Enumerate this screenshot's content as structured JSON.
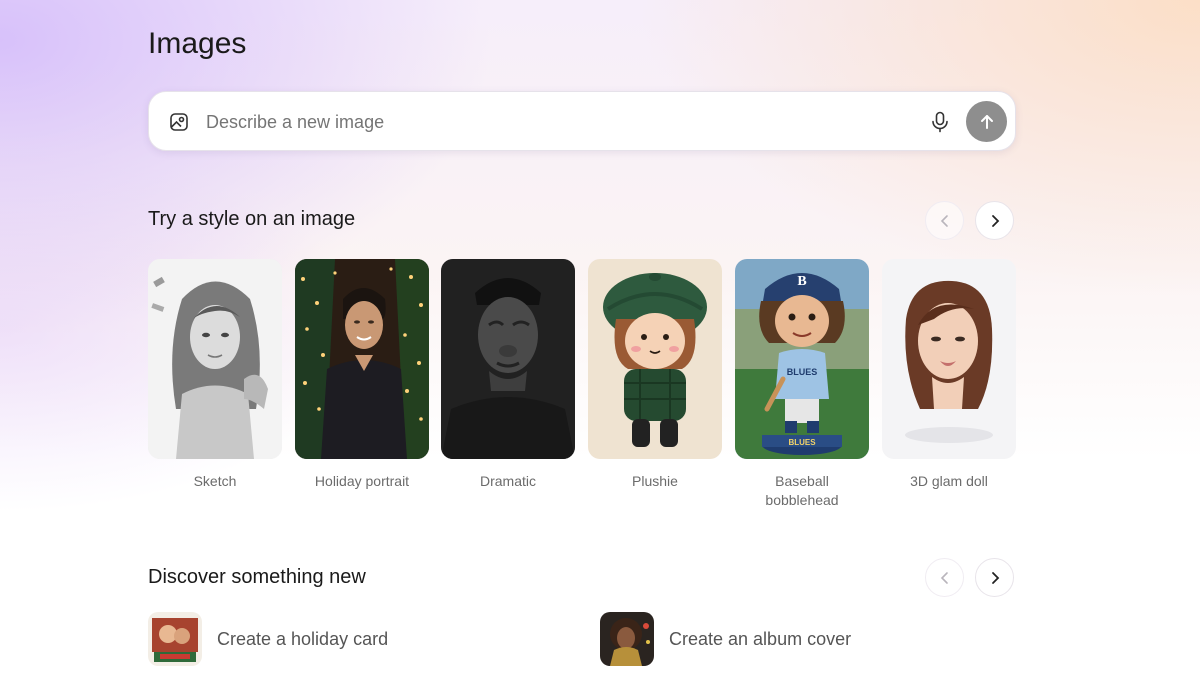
{
  "page": {
    "title": "Images"
  },
  "search": {
    "placeholder": "Describe a new image",
    "icons": {
      "image": "image-icon",
      "mic": "microphone-icon",
      "send": "arrow-up-icon"
    }
  },
  "styles_section": {
    "title": "Try a style on an image",
    "items": [
      {
        "label": "Sketch"
      },
      {
        "label": "Holiday portrait"
      },
      {
        "label": "Dramatic"
      },
      {
        "label": "Plushie"
      },
      {
        "label": "Baseball bobblehead"
      },
      {
        "label": "3D glam doll"
      }
    ]
  },
  "discover_section": {
    "title": "Discover something new",
    "items": [
      {
        "label": "Create a holiday card"
      },
      {
        "label": "Create an album cover"
      }
    ]
  },
  "colors": {
    "send_button": "#8e8e8e",
    "text": "#1f1f1f",
    "muted": "#6b6b6b"
  }
}
